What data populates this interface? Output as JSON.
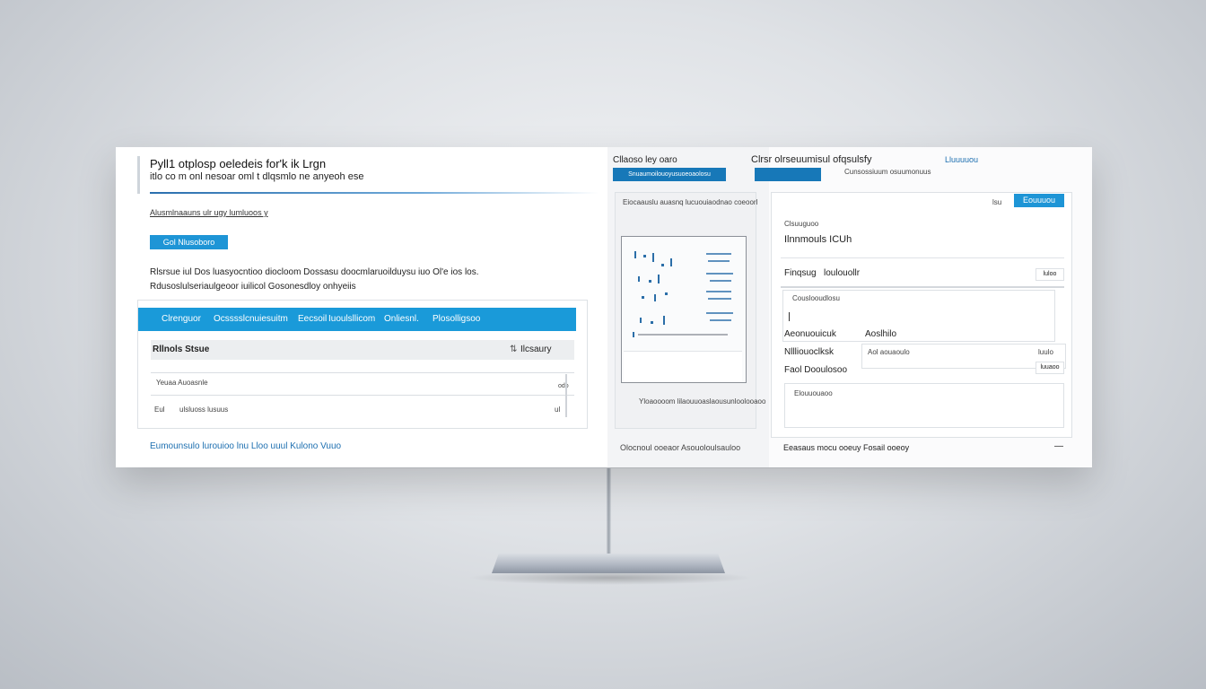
{
  "left": {
    "title_line1": "Pyll1 otplosp oeledeis for'k ik Lrgn",
    "title_line2": "itlo co m onl nesoar oml t dlqsmlo ne anyeoh ese",
    "breadcrumb": "Alusmlnaauns ulr ugy lumluoos y",
    "primary_button": "Gol Nlusoboro",
    "desc_line1": "Rlsrsue iul Dos luasyocntioo diocloom Dossasu doocmlaruoilduysu iuo Ol'e ios los.",
    "desc_line2": "Rdusoslulseriaulgeoor  iuilicol Gosonesdloy onhyeiis",
    "table": {
      "header_labels": [
        "Clrenguor",
        "Ocsssslcnuiesuitm",
        "Eecsoil",
        "Iuoulsllicom",
        "Onliesnl.",
        "Plosolligsoo"
      ],
      "col_title": "Rllnols Stsue",
      "col_right": "Ilcsaury",
      "rows": [
        {
          "label": "Yeuaa  Auoasnle",
          "right": "odo"
        },
        {
          "label": "ulsluoss  lusuus",
          "left_icon": "Eul",
          "right": "ul"
        }
      ]
    },
    "footer_link": "Eumounsulo  lurouioo  lnu  Lloo  uuul  Kulono  Vuuo"
  },
  "middle": {
    "tab_label": "Cllaoso ley oaro",
    "tab_button": "Snuaumoilouoyusuoeoaolosu",
    "panel_header": "Eiocaauslu  auasnq  lucuouiaodnao  coeoorl",
    "caption": "Yloaoooom  lilaouuoaslaousunloolooaoo",
    "footer": "Olocnoul ooeaor  Asouoloulsauloo"
  },
  "right": {
    "header_title": "Clrsr olrseuumisul ofqsulsfy",
    "header_button": "",
    "header_sub": "Cunsossiuum  osuumonuus",
    "header_link": "Lluuuuou",
    "top_small": "lsu",
    "top_button": "Eouuuou",
    "section1_label": "Clsuuguoo",
    "section1_value": "Ilnnmouls ICUh",
    "row1_label": "Finqsug",
    "row1_value": "loulouollr",
    "row1_btn": "luloo",
    "textarea_label": "Couslooudlosu",
    "form_labels": [
      "Aeonuouicuk",
      "Nllliouoclksk",
      "Faol  Dooulosoo"
    ],
    "form_value": "Aoslhilo",
    "form_field_text": "Aol  aouaoulo",
    "form_btn1": "luulo",
    "form_btn2": "luuaoo",
    "notes_label": "Elouuouaoo",
    "footer_text": "Eeasaus mocu ooeuy  Fosail ooeoy",
    "footer_icon": "—"
  }
}
